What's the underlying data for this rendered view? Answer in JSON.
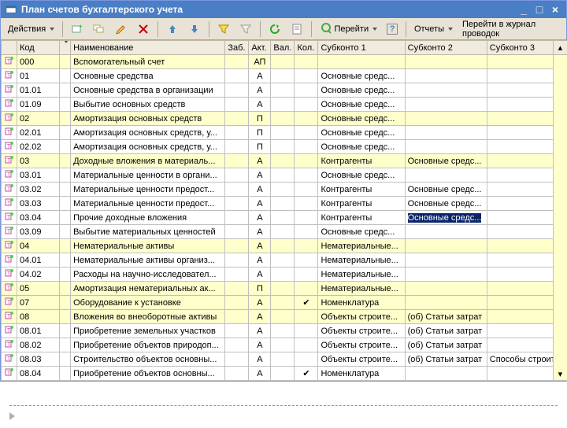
{
  "title": "План счетов бухгалтерского учета",
  "toolbar": {
    "actions": "Действия",
    "goto": "Перейти",
    "reports": "Отчеты",
    "journal": "Перейти в журнал проводок"
  },
  "columns": {
    "code": "Код",
    "name": "Наименование",
    "zab": "Заб.",
    "akt": "Акт.",
    "val": "Вал.",
    "kol": "Кол.",
    "sub1": "Субконто 1",
    "sub2": "Субконто 2",
    "sub3": "Субконто 3"
  },
  "rows": [
    {
      "hl": true,
      "code": "000",
      "name": "Вспомогательный счет",
      "akt": "АП",
      "sub1": "",
      "sub2": "",
      "sub3": ""
    },
    {
      "hl": false,
      "code": "01",
      "name": "Основные средства",
      "akt": "А",
      "sub1": "Основные средс...",
      "sub2": "",
      "sub3": ""
    },
    {
      "hl": false,
      "code": "01.01",
      "name": "Основные средства в организации",
      "akt": "А",
      "sub1": "Основные средс...",
      "sub2": "",
      "sub3": ""
    },
    {
      "hl": false,
      "code": "01.09",
      "name": "Выбытие основных средств",
      "akt": "А",
      "sub1": "Основные средс...",
      "sub2": "",
      "sub3": ""
    },
    {
      "hl": true,
      "code": "02",
      "name": "Амортизация основных средств",
      "akt": "П",
      "sub1": "Основные средс...",
      "sub2": "",
      "sub3": ""
    },
    {
      "hl": false,
      "code": "02.01",
      "name": "Амортизация основных средств, у...",
      "akt": "П",
      "sub1": "Основные средс...",
      "sub2": "",
      "sub3": ""
    },
    {
      "hl": false,
      "code": "02.02",
      "name": "Амортизация основных средств, у...",
      "akt": "П",
      "sub1": "Основные средс...",
      "sub2": "",
      "sub3": ""
    },
    {
      "hl": true,
      "code": "03",
      "name": "Доходные вложения в материаль...",
      "akt": "А",
      "sub1": "Контрагенты",
      "sub2": "Основные средс...",
      "sub3": ""
    },
    {
      "hl": false,
      "code": "03.01",
      "name": "Материальные ценности в органи...",
      "akt": "А",
      "sub1": "Основные средс...",
      "sub2": "",
      "sub3": ""
    },
    {
      "hl": false,
      "code": "03.02",
      "name": "Материальные ценности предост...",
      "akt": "А",
      "sub1": "Контрагенты",
      "sub2": "Основные средс...",
      "sub3": ""
    },
    {
      "hl": false,
      "code": "03.03",
      "name": "Материальные ценности предост...",
      "akt": "А",
      "sub1": "Контрагенты",
      "sub2": "Основные средс...",
      "sub3": ""
    },
    {
      "hl": false,
      "code": "03.04",
      "name": "Прочие доходные вложения",
      "akt": "А",
      "sub1": "Контрагенты",
      "sub2": "Основные средс...",
      "sub3": "",
      "sub2_sel": true
    },
    {
      "hl": false,
      "code": "03.09",
      "name": "Выбытие материальных ценностей",
      "akt": "А",
      "sub1": "Основные средс...",
      "sub2": "",
      "sub3": ""
    },
    {
      "hl": true,
      "code": "04",
      "name": "Нематериальные активы",
      "akt": "А",
      "sub1": "Нематериальные...",
      "sub2": "",
      "sub3": ""
    },
    {
      "hl": false,
      "code": "04.01",
      "name": "Нематериальные активы организ...",
      "akt": "А",
      "sub1": "Нематериальные...",
      "sub2": "",
      "sub3": ""
    },
    {
      "hl": false,
      "code": "04.02",
      "name": "Расходы на научно-исследовател...",
      "akt": "А",
      "sub1": "Нематериальные...",
      "sub2": "",
      "sub3": ""
    },
    {
      "hl": true,
      "code": "05",
      "name": "Амортизация нематериальных ак...",
      "akt": "П",
      "sub1": "Нематериальные...",
      "sub2": "",
      "sub3": ""
    },
    {
      "hl": true,
      "code": "07",
      "name": "Оборудование к установке",
      "akt": "А",
      "kol": "✔",
      "sub1": "Номенклатура",
      "sub2": "",
      "sub3": ""
    },
    {
      "hl": true,
      "code": "08",
      "name": "Вложения во внеоборотные активы",
      "akt": "А",
      "sub1": "Объекты строите...",
      "sub2": "(об) Статьи затрат",
      "sub3": ""
    },
    {
      "hl": false,
      "code": "08.01",
      "name": "Приобретение земельных участков",
      "akt": "А",
      "sub1": "Объекты строите...",
      "sub2": "(об) Статьи затрат",
      "sub3": ""
    },
    {
      "hl": false,
      "code": "08.02",
      "name": "Приобретение объектов природоп...",
      "akt": "А",
      "sub1": "Объекты строите...",
      "sub2": "(об) Статьи затрат",
      "sub3": ""
    },
    {
      "hl": false,
      "code": "08.03",
      "name": "Строительство объектов основны...",
      "akt": "А",
      "sub1": "Объекты строите...",
      "sub2": "(об) Статьи затрат",
      "sub3": "Способы строите..."
    },
    {
      "hl": false,
      "code": "08.04",
      "name": "Приобретение объектов основны...",
      "akt": "А",
      "kol": "✔",
      "sub1": "Номенклатура",
      "sub2": "",
      "sub3": ""
    }
  ]
}
